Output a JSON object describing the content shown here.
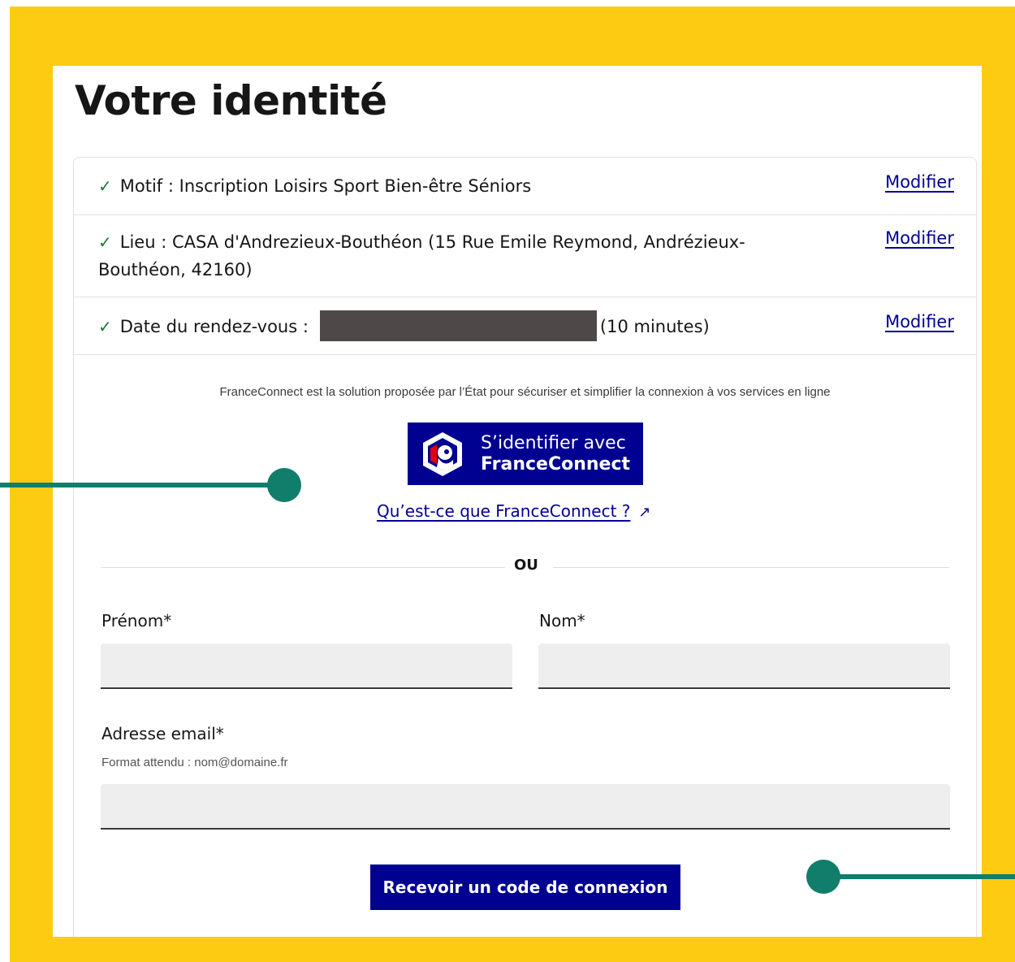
{
  "page": {
    "title": "Votre identité"
  },
  "recap": [
    {
      "label": "Motif : Inscription Loisirs Sport Bien-être Séniors",
      "action": "Modifier"
    },
    {
      "label": "Lieu : CASA d'Andrezieux-Bouthéon (15 Rue Emile Reymond, Andrézieux-Bouthéon, 42160)",
      "action": "Modifier"
    },
    {
      "label_prefix": "Date du rendez-vous :",
      "label_suffix": "(10 minutes)",
      "action": "Modifier"
    }
  ],
  "franceconnect": {
    "intro": "FranceConnect est la solution proposée par l’État pour sécuriser et simplifier la connexion à vos services en ligne",
    "button_line1": "S’identifier avec",
    "button_line2": "FranceConnect",
    "link": "Qu’est-ce que FranceConnect ?"
  },
  "separator": "OU",
  "form": {
    "first_name_label": "Prénom*",
    "first_name_value": "",
    "last_name_label": "Nom*",
    "last_name_value": "",
    "email_label": "Adresse email*",
    "email_hint": "Format attendu : nom@domaine.fr",
    "email_value": ""
  },
  "submit_label": "Recevoir un code de connexion",
  "colors": {
    "frame": "#fecb13",
    "primary": "#000091",
    "annotation": "#117d6b",
    "check": "#18753c"
  },
  "icons": [
    "check-icon",
    "external-link-icon",
    "marianne-logo-icon"
  ]
}
